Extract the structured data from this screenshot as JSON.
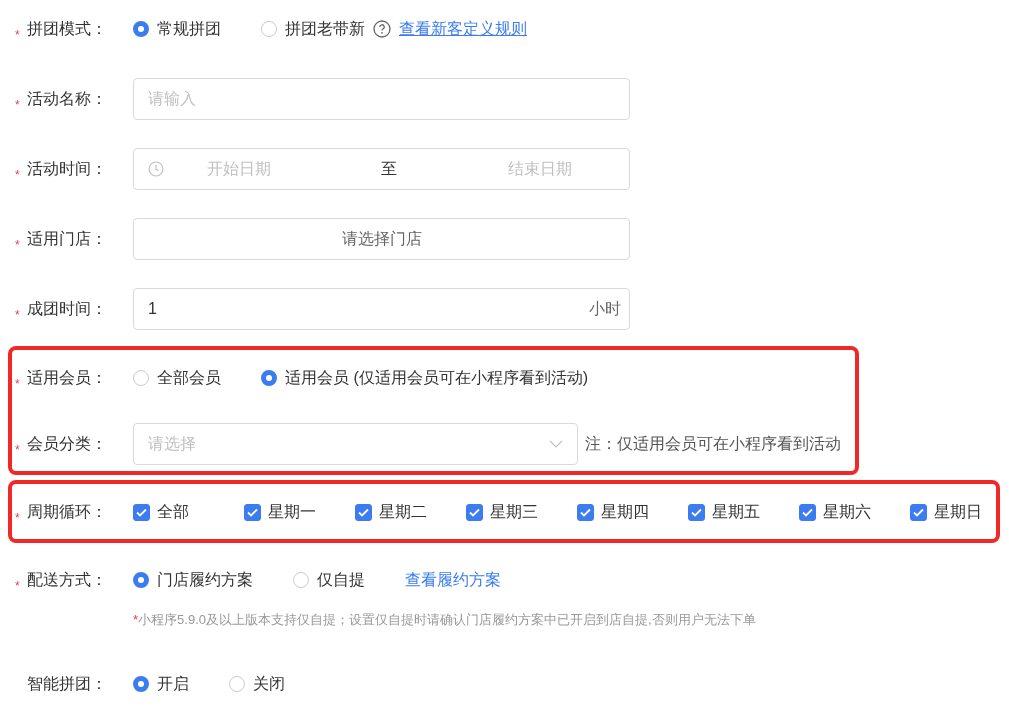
{
  "sections": [
    {
      "highlighted": false,
      "rows": [
        {
          "kind": "radio",
          "mark": "*",
          "label": "拼团模式：",
          "options": [
            {
              "label": "常规拼团",
              "selected": true
            },
            {
              "label": "拼团老带新",
              "selected": false
            }
          ],
          "help_icon": true,
          "link": {
            "text": "查看新客定义规则",
            "underlined": true
          }
        },
        {
          "kind": "input",
          "mark": "*",
          "label": "活动名称：",
          "placeholder": "请输入"
        },
        {
          "kind": "date_range",
          "mark": "*",
          "label": "活动时间：",
          "start_placeholder": "开始日期",
          "separator": "至",
          "end_placeholder": "结束日期"
        },
        {
          "kind": "picker",
          "mark": "*",
          "label": "适用门店：",
          "text": "请选择门店"
        },
        {
          "kind": "number_unit",
          "mark": "*",
          "label": "成团时间：",
          "value": "1",
          "unit": "小时"
        }
      ]
    },
    {
      "highlighted": true,
      "rows": [
        {
          "kind": "radio",
          "mark": "*",
          "label": "适用会员：",
          "options": [
            {
              "label": "全部会员",
              "selected": false
            },
            {
              "label": "适用会员 (仅适用会员可在小程序看到活动)",
              "selected": true
            }
          ]
        },
        {
          "kind": "select",
          "mark": "*",
          "label": "会员分类：",
          "placeholder": "请选择",
          "note": "注：仅适用会员可在小程序看到活动"
        }
      ]
    },
    {
      "highlighted": true,
      "rows": [
        {
          "kind": "checkbox",
          "mark": "*",
          "label": "周期循环：",
          "options": [
            {
              "label": "全部",
              "checked": true
            },
            {
              "label": "星期一",
              "checked": true
            },
            {
              "label": "星期二",
              "checked": true
            },
            {
              "label": "星期三",
              "checked": true
            },
            {
              "label": "星期四",
              "checked": true
            },
            {
              "label": "星期五",
              "checked": true
            },
            {
              "label": "星期六",
              "checked": true
            },
            {
              "label": "星期日",
              "checked": true
            }
          ]
        }
      ]
    },
    {
      "highlighted": false,
      "rows": [
        {
          "kind": "radio",
          "mark": "*",
          "label": "配送方式：",
          "options": [
            {
              "label": "门店履约方案",
              "selected": true
            },
            {
              "label": "仅自提",
              "selected": false
            }
          ],
          "link": {
            "text": "查看履约方案",
            "underlined": false
          },
          "hint_mark": "*",
          "hint": "小程序5.9.0及以上版本支持仅自提；设置仅自提时请确认门店履约方案中已开启到店自提,否则用户无法下单"
        },
        {
          "kind": "radio",
          "label": "智能拼团：",
          "options": [
            {
              "label": "开启",
              "selected": true
            },
            {
              "label": "关闭",
              "selected": false
            }
          ]
        }
      ]
    }
  ]
}
